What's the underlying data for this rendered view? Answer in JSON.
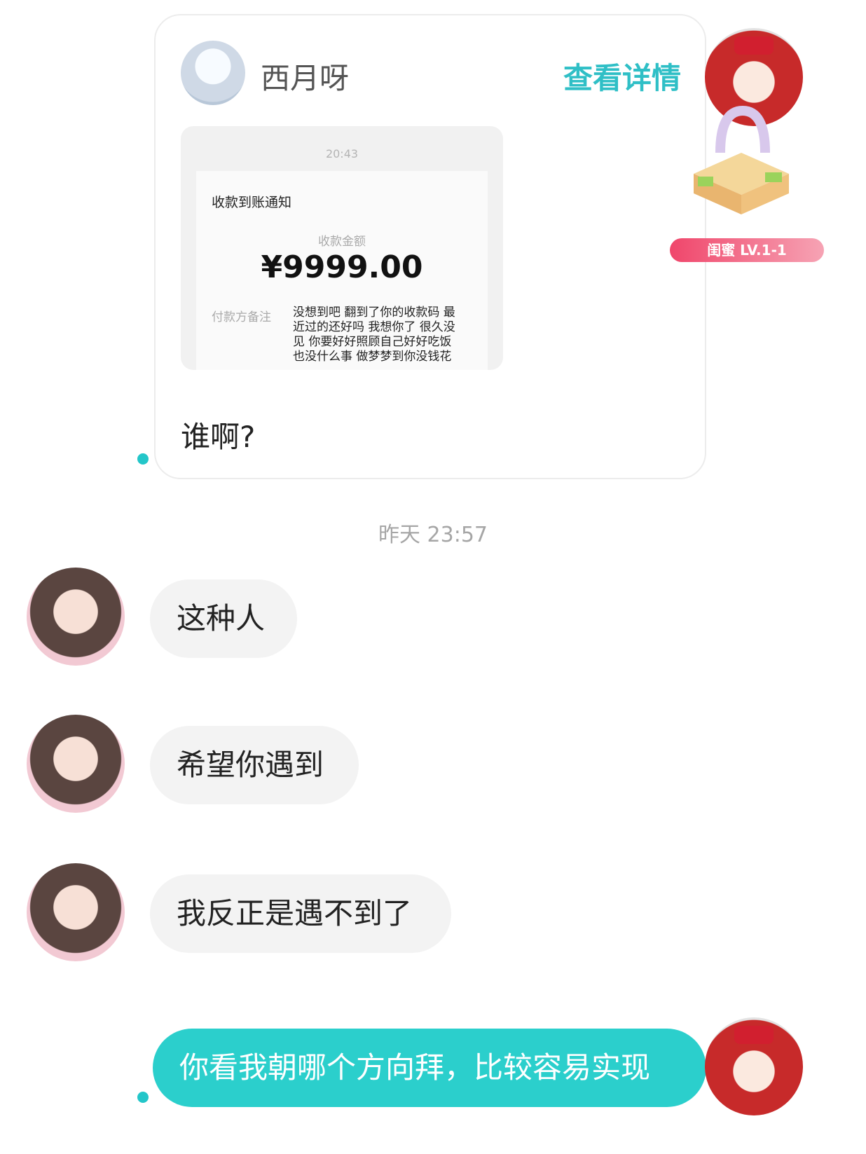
{
  "shared_card": {
    "sender_name": "西月呀",
    "view_detail": "查看详情",
    "screenshot": {
      "time": "20:43",
      "notice_title": "收款到账通知",
      "amount_label": "收款金额",
      "amount": "¥9999.00",
      "remark_label": "付款方备注",
      "remark_text": "没想到吧 翻到了你的收款码 最近过的还好吗 我想你了 很久没见 你要好好照顾自己好好吃饭 也没什么事 做梦梦到你没钱花"
    },
    "message": "谁啊?"
  },
  "level_badge": "闺蜜 LV.1-1",
  "timestamp": "昨天 23:57",
  "incoming": [
    {
      "text": "这种人"
    },
    {
      "text": "希望你遇到"
    },
    {
      "text": "我反正是遇不到了"
    }
  ],
  "outgoing": {
    "text": "你看我朝哪个方向拜，比较容易实现"
  },
  "colors": {
    "accent": "#2bcfcc",
    "bubble_in": "#f3f3f3",
    "badge": "#f0466b"
  }
}
